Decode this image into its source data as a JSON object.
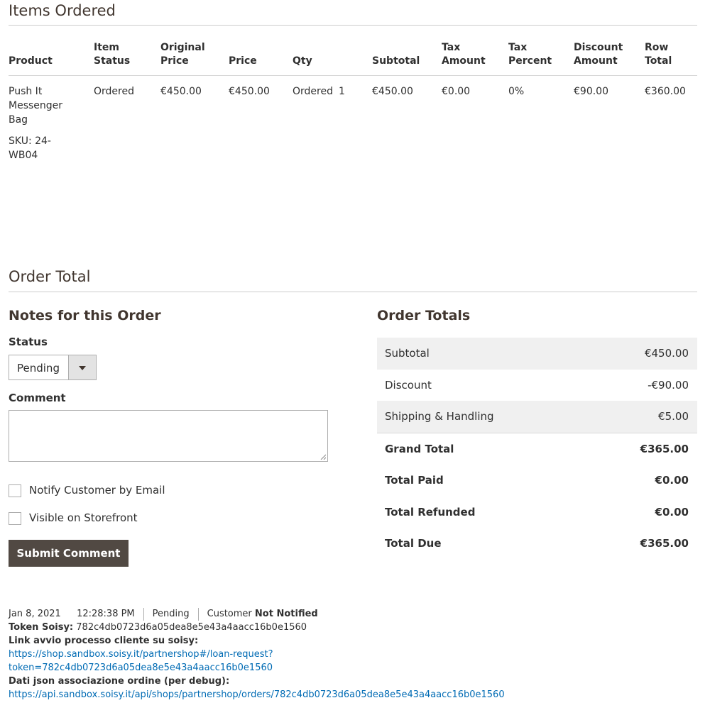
{
  "items_section": {
    "title": "Items Ordered",
    "headers": {
      "product": "Product",
      "item_status_1": "Item",
      "item_status_2": "Status",
      "original_price_1": "Original",
      "original_price_2": "Price",
      "price": "Price",
      "qty": "Qty",
      "subtotal": "Subtotal",
      "tax_amount_1": "Tax",
      "tax_amount_2": "Amount",
      "tax_percent_1": "Tax",
      "tax_percent_2": "Percent",
      "discount_amount_1": "Discount",
      "discount_amount_2": "Amount",
      "row_total_1": "Row",
      "row_total_2": "Total"
    },
    "row": {
      "product_line1": "Push It",
      "product_line2": "Messenger",
      "product_line3": "Bag",
      "sku_line1": "SKU: 24-",
      "sku_line2": "WB04",
      "item_status": "Ordered",
      "original_price": "€450.00",
      "price": "€450.00",
      "qty_label": "Ordered",
      "qty_value": "1",
      "subtotal": "€450.00",
      "tax_amount": "€0.00",
      "tax_percent": "0%",
      "discount_amount": "€90.00",
      "row_total": "€360.00"
    }
  },
  "order_total_section": {
    "title": "Order Total",
    "notes": {
      "title": "Notes for this Order",
      "status_label": "Status",
      "status_value": "Pending",
      "comment_label": "Comment",
      "notify_label": "Notify Customer by Email",
      "visible_label": "Visible on Storefront",
      "submit_label": "Submit Comment"
    },
    "totals": {
      "title": "Order Totals",
      "subtotal_label": "Subtotal",
      "subtotal_value": "€450.00",
      "discount_label": "Discount",
      "discount_value": "-€90.00",
      "shipping_label": "Shipping & Handling",
      "shipping_value": "€5.00",
      "grand_total_label": "Grand Total",
      "grand_total_value": "€365.00",
      "total_paid_label": "Total Paid",
      "total_paid_value": "€0.00",
      "total_refunded_label": "Total Refunded",
      "total_refunded_value": "€0.00",
      "total_due_label": "Total Due",
      "total_due_value": "€365.00"
    }
  },
  "history": {
    "date": "Jan 8, 2021",
    "time": "12:28:38 PM",
    "status": "Pending",
    "customer_prefix": "Customer",
    "customer_state": "Not Notified",
    "token_label": "Token Soisy:",
    "token_value": "782c4db0723d6a05dea8e5e43a4aacc16b0e1560",
    "link_label": "Link avvio processo cliente su soisy:",
    "link_line1": "https://shop.sandbox.soisy.it/partnershop#/loan-request?",
    "link_line2": "token=782c4db0723d6a05dea8e5e43a4aacc16b0e1560",
    "json_label": "Dati json associazione ordine (per debug):",
    "json_link": "https://api.sandbox.soisy.it/api/shops/partnershop/orders/782c4db0723d6a05dea8e5e43a4aacc16b0e1560"
  },
  "colors": {
    "heading": "#41362f",
    "button_bg": "#514943",
    "link": "#006bb4",
    "shaded_row": "#f0f0f0"
  }
}
